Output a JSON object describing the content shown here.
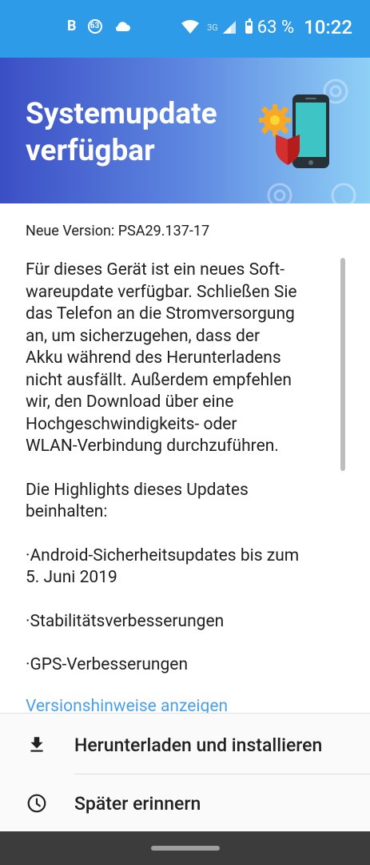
{
  "status_bar": {
    "left_icons": [
      "B",
      "63"
    ],
    "network": "3G",
    "battery": "63 %",
    "time": "10:22"
  },
  "header": {
    "title": "Systemupdate\nverfügbar"
  },
  "content": {
    "version": "Neue Version: PSA29.137-17",
    "description": "Für dieses Gerät ist ein neues Soft-\nwareupdate verfügbar. Schließen Sie\ndas Telefon an die Stromversorgung\nan, um sicherzugehen, dass der\nAkku während des Herunterladens\nnicht ausfällt. Außerdem empfehlen\nwir, den Download über eine\nHochgeschwindigkeits- oder\nWLAN-Verbindung durchzuführen.",
    "highlights_intro": "Die Highlights dieses Updates\nbeinhalten:",
    "bullets": [
      "·Android-Sicherheitsupdates bis zum\n 5. Juni 2019",
      "·Stabilitätsverbesserungen",
      "·GPS-Verbesserungen"
    ],
    "faded_link": "Versionshinweise anzeigen"
  },
  "actions": {
    "download_label": "Herunterladen und installieren",
    "remind_label": "Später erinnern"
  },
  "colors": {
    "status_bar": "#2e9be8",
    "header_gradient_start": "#3b4fc5",
    "header_gradient_end": "#8fd0f6",
    "link": "#1e88e5"
  }
}
